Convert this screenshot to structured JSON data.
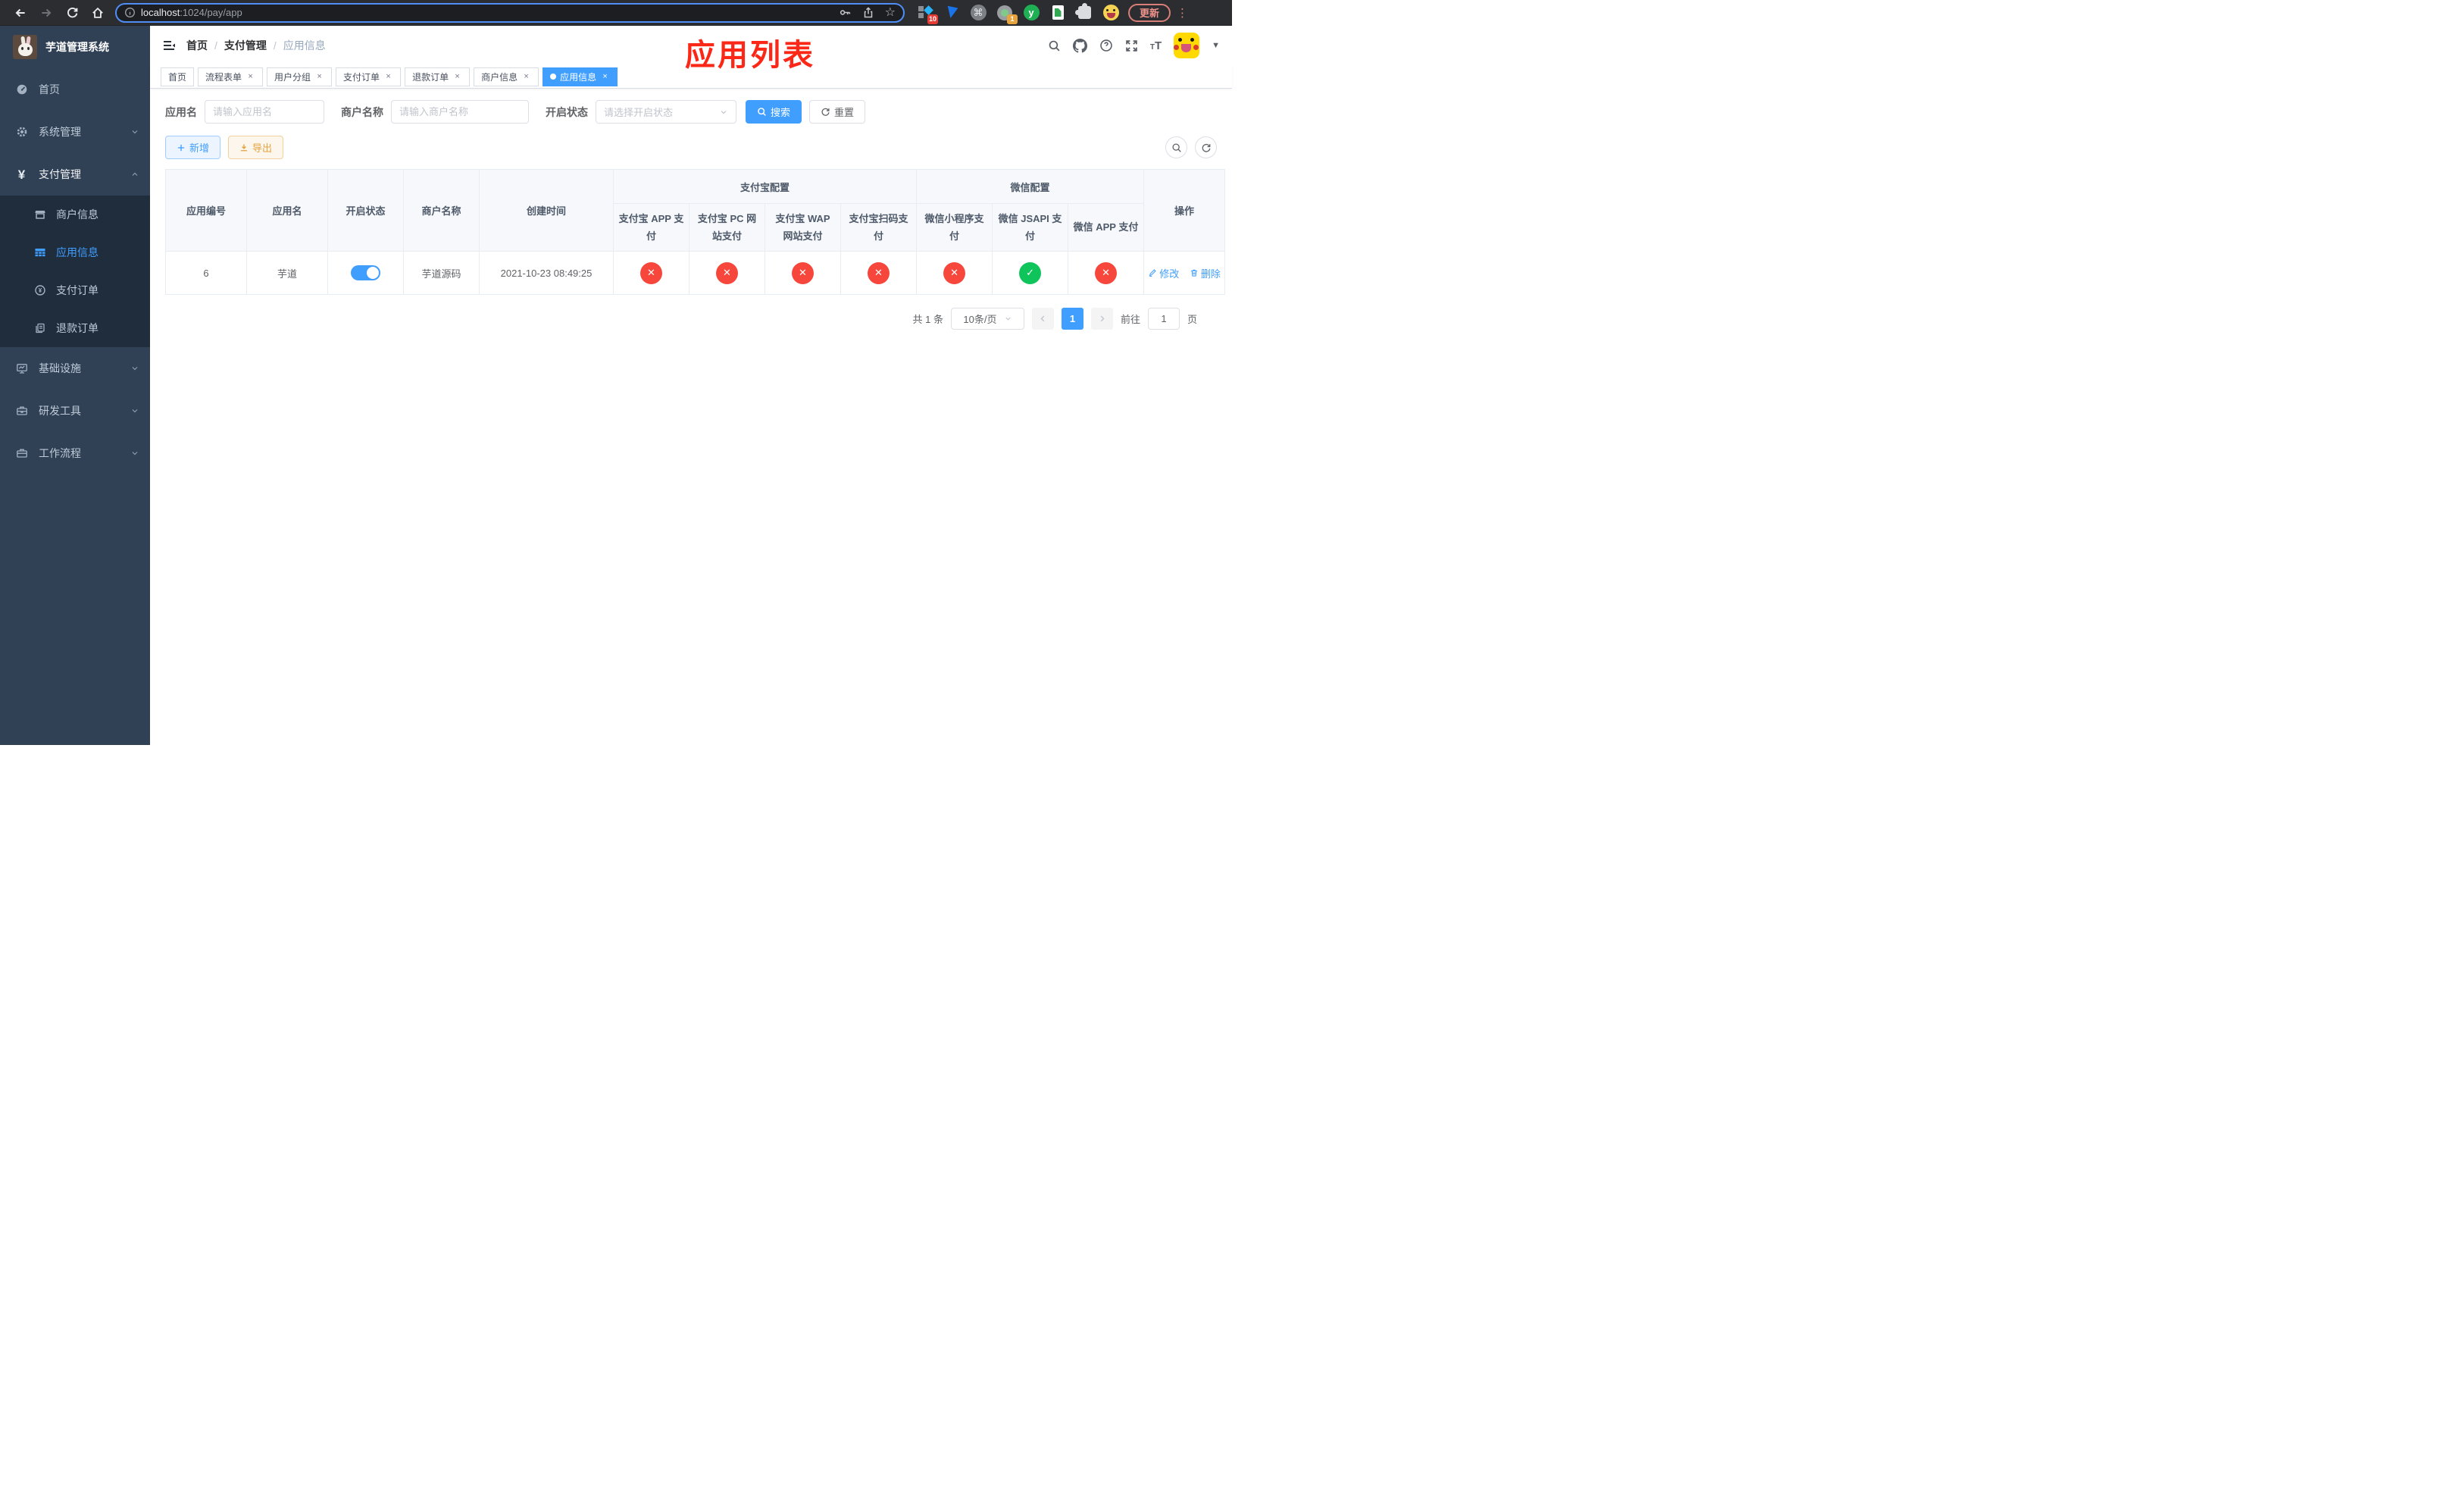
{
  "browser": {
    "url_host": "localhost",
    "url_path": ":1024/pay/app",
    "ext_badge_1": "10",
    "ext_badge_2": "1",
    "update_label": "更新"
  },
  "sidebar": {
    "title": "芋道管理系统",
    "items": [
      {
        "label": "首页"
      },
      {
        "label": "系统管理"
      },
      {
        "label": "支付管理"
      },
      {
        "label": "商户信息"
      },
      {
        "label": "应用信息"
      },
      {
        "label": "支付订单"
      },
      {
        "label": "退款订单"
      },
      {
        "label": "基础设施"
      },
      {
        "label": "研发工具"
      },
      {
        "label": "工作流程"
      }
    ]
  },
  "navbar": {
    "breadcrumb": [
      "首页",
      "支付管理",
      "应用信息"
    ],
    "annotation": "应用列表"
  },
  "tabs": [
    {
      "label": "首页",
      "closable": false,
      "active": false
    },
    {
      "label": "流程表单",
      "closable": true,
      "active": false
    },
    {
      "label": "用户分组",
      "closable": true,
      "active": false
    },
    {
      "label": "支付订单",
      "closable": true,
      "active": false
    },
    {
      "label": "退款订单",
      "closable": true,
      "active": false
    },
    {
      "label": "商户信息",
      "closable": true,
      "active": false
    },
    {
      "label": "应用信息",
      "closable": true,
      "active": true
    }
  ],
  "filters": {
    "app_name_label": "应用名",
    "app_name_placeholder": "请输入应用名",
    "merchant_label": "商户名称",
    "merchant_placeholder": "请输入商户名称",
    "status_label": "开启状态",
    "status_placeholder": "请选择开启状态",
    "search_label": "搜索",
    "reset_label": "重置"
  },
  "toolbar": {
    "add_label": "新增",
    "export_label": "导出"
  },
  "table": {
    "group_headers": {
      "alipay": "支付宝配置",
      "wechat": "微信配置"
    },
    "columns": [
      "应用编号",
      "应用名",
      "开启状态",
      "商户名称",
      "创建时间",
      "支付宝 APP 支付",
      "支付宝 PC 网站支付",
      "支付宝 WAP 网站支付",
      "支付宝扫码支付",
      "微信小程序支付",
      "微信 JSAPI 支付",
      "微信 APP 支付",
      "操作"
    ],
    "rows": [
      {
        "id": "6",
        "name": "芋道",
        "enabled": true,
        "merchant": "芋道源码",
        "created": "2021-10-23 08:49:25",
        "pay_status": [
          false,
          false,
          false,
          false,
          false,
          true,
          false
        ],
        "edit_label": "修改",
        "delete_label": "删除"
      }
    ]
  },
  "pagination": {
    "total": "共 1 条",
    "page_size": "10条/页",
    "page": "1",
    "goto_label": "前往",
    "goto_value": "1",
    "page_label": "页"
  },
  "colors": {
    "accent": "#409eff",
    "status_on": "#0fc45a",
    "status_off": "#f7473c",
    "warning": "#e6a23c",
    "annotation": "#fb2817"
  }
}
